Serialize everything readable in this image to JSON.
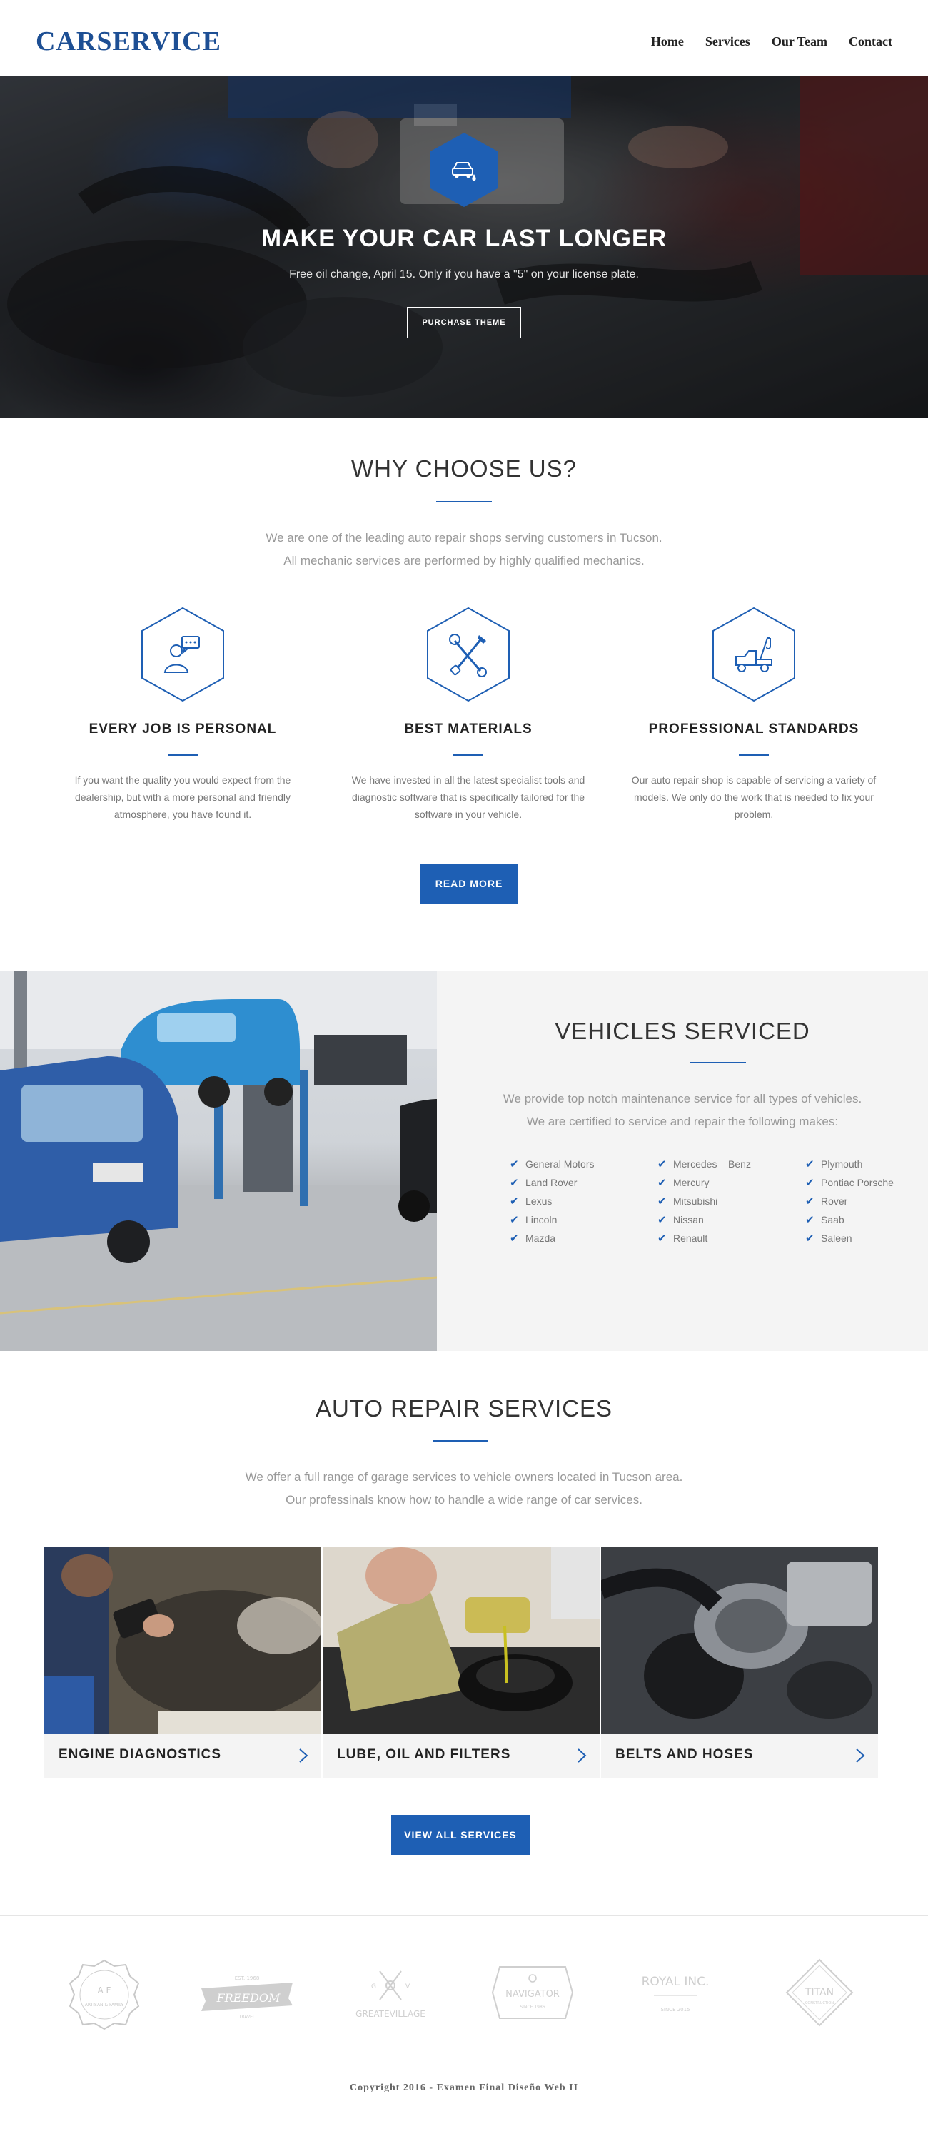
{
  "header": {
    "logo": "CARSERVICE",
    "nav": [
      "Home",
      "Services",
      "Our Team",
      "Contact"
    ]
  },
  "hero": {
    "icon": "car-oil-drop-icon",
    "title": "MAKE YOUR CAR LAST LONGER",
    "subtitle": "Free oil change, April 15. Only if you have a \"5\" on your license plate.",
    "button": "PURCHASE THEME"
  },
  "why": {
    "title": "WHY CHOOSE US?",
    "intro": [
      "We are one of the leading auto repair shops serving customers in Tucson.",
      "All mechanic services are performed by highly qualified mechanics."
    ],
    "features": [
      {
        "icon": "user-chat-icon",
        "title": "EVERY JOB IS PERSONAL",
        "text": "If you want the quality you would expect from the dealership, but with a more personal and friendly atmosphere, you have found it."
      },
      {
        "icon": "wrench-screwdriver-icon",
        "title": "BEST MATERIALS",
        "text": "We have invested in all the latest specialist tools and diagnostic software that is specifically tailored for the software in your vehicle."
      },
      {
        "icon": "tow-truck-icon",
        "title": "PROFESSIONAL STANDARDS",
        "text": "Our auto repair shop is capable of servicing a variety of models. We only do the work that is needed to fix your problem."
      }
    ],
    "button": "READ MORE"
  },
  "vehicles": {
    "title": "VEHICLES SERVICED",
    "intro": [
      "We provide top notch maintenance service for all types of vehicles.",
      "We are certified to service and repair the following makes:"
    ],
    "makes": [
      [
        "General Motors",
        "Land Rover",
        "Lexus",
        "Lincoln",
        "Mazda"
      ],
      [
        "Mercedes – Benz",
        "Mercury",
        "Mitsubishi",
        "Nissan",
        "Renault"
      ],
      [
        "Plymouth",
        "Pontiac Porsche",
        "Rover",
        "Saab",
        "Saleen"
      ]
    ]
  },
  "services": {
    "title": "AUTO REPAIR SERVICES",
    "intro": [
      "We offer a full range of garage services to vehicle owners located in Tucson area.",
      "Our professinals know how to handle a wide range of car services."
    ],
    "items": [
      {
        "label": "ENGINE DIAGNOSTICS"
      },
      {
        "label": "LUBE, OIL AND FILTERS"
      },
      {
        "label": "BELTS AND HOSES"
      }
    ],
    "button": "VIEW ALL SERVICES"
  },
  "partners": [
    {
      "name": "badge-logo",
      "text": "ARTISAN & FAMILY"
    },
    {
      "name": "freedom-logo",
      "text": "FREEDOM"
    },
    {
      "name": "greatevillage-logo",
      "text": "GREATEVILLAGE"
    },
    {
      "name": "navigator-logo",
      "text": "NAVIGATOR"
    },
    {
      "name": "royal-logo",
      "text": "ROYAL INC."
    },
    {
      "name": "titan-logo",
      "text": "TITAN"
    }
  ],
  "footer": {
    "copyright": "Copyright 2016 - Examen Final Diseño Web II"
  },
  "colors": {
    "brand": "#1e5fb4",
    "logo": "#1d4f94",
    "panel": "#f4f4f4"
  }
}
